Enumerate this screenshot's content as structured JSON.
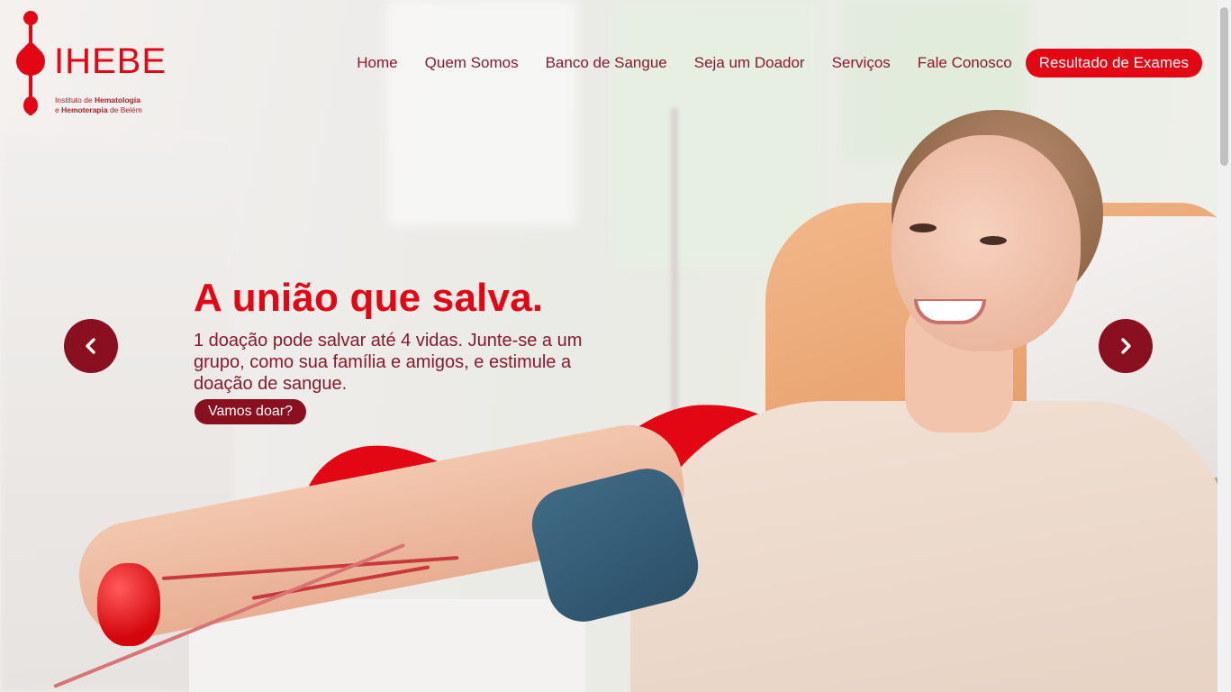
{
  "brand": {
    "name": "IHEBE",
    "subtitle_line1_pre": "Instituto de ",
    "subtitle_line1_bold": "Hematologia",
    "subtitle_line2_pre": "e ",
    "subtitle_line2_bold": "Hemoterapia",
    "subtitle_line2_post": " de Belém",
    "color": "#e30613"
  },
  "nav": {
    "items": [
      {
        "label": "Home"
      },
      {
        "label": "Quem Somos"
      },
      {
        "label": "Banco de Sangue"
      },
      {
        "label": "Seja um Doador"
      },
      {
        "label": "Serviços"
      },
      {
        "label": "Fale Conosco"
      }
    ],
    "cta_label": "Resultado de Exames"
  },
  "hero": {
    "title": "A união que salva.",
    "text": "1 doação pode salvar até 4 vidas. Junte-se a um grupo, como sua família e amigos, e estimule a doação de sangue.",
    "button_label": "Vamos doar?"
  },
  "carousel": {
    "prev_icon": "chevron-left-icon",
    "next_icon": "chevron-right-icon"
  },
  "colors": {
    "primary_red": "#e30613",
    "dark_red": "#8a0f1f",
    "nav_text": "#8a1a2a"
  }
}
